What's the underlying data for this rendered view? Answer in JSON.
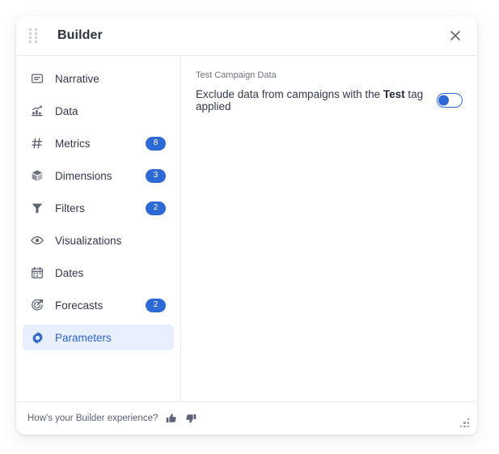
{
  "window": {
    "title": "Builder",
    "drag_handle_icon": "drag-dots-icon",
    "close_icon": "close-icon"
  },
  "sidebar": {
    "items": [
      {
        "label": "Narrative",
        "icon": "narrative-icon",
        "badge": null,
        "selected": false
      },
      {
        "label": "Data",
        "icon": "data-chart-icon",
        "badge": null,
        "selected": false
      },
      {
        "label": "Metrics",
        "icon": "hash-icon",
        "badge": "8",
        "selected": false
      },
      {
        "label": "Dimensions",
        "icon": "cube-icon",
        "badge": "3",
        "selected": false
      },
      {
        "label": "Filters",
        "icon": "funnel-icon",
        "badge": "2",
        "selected": false
      },
      {
        "label": "Visualizations",
        "icon": "eye-icon",
        "badge": null,
        "selected": false
      },
      {
        "label": "Dates",
        "icon": "calendar-icon",
        "badge": null,
        "selected": false
      },
      {
        "label": "Forecasts",
        "icon": "target-arrow-icon",
        "badge": "2",
        "selected": false
      },
      {
        "label": "Parameters",
        "icon": "gear-icon",
        "badge": null,
        "selected": true
      }
    ]
  },
  "main": {
    "section_label": "Test Campaign Data",
    "setting": {
      "text_before": "Exclude data from campaigns with the ",
      "text_emphasis": "Test",
      "text_after": " tag applied",
      "toggle_state": "off"
    }
  },
  "footer": {
    "feedback_prompt": "How's your Builder experience?",
    "thumbs_up_icon": "thumbs-up-icon",
    "thumbs_down_icon": "thumbs-down-icon",
    "resize_icon": "resize-grip-icon"
  },
  "colors": {
    "accent": "#2d6ad6",
    "selected_bg": "#e8efff",
    "text": "#33384a",
    "muted": "#6e7380",
    "border": "#e9eaee"
  }
}
